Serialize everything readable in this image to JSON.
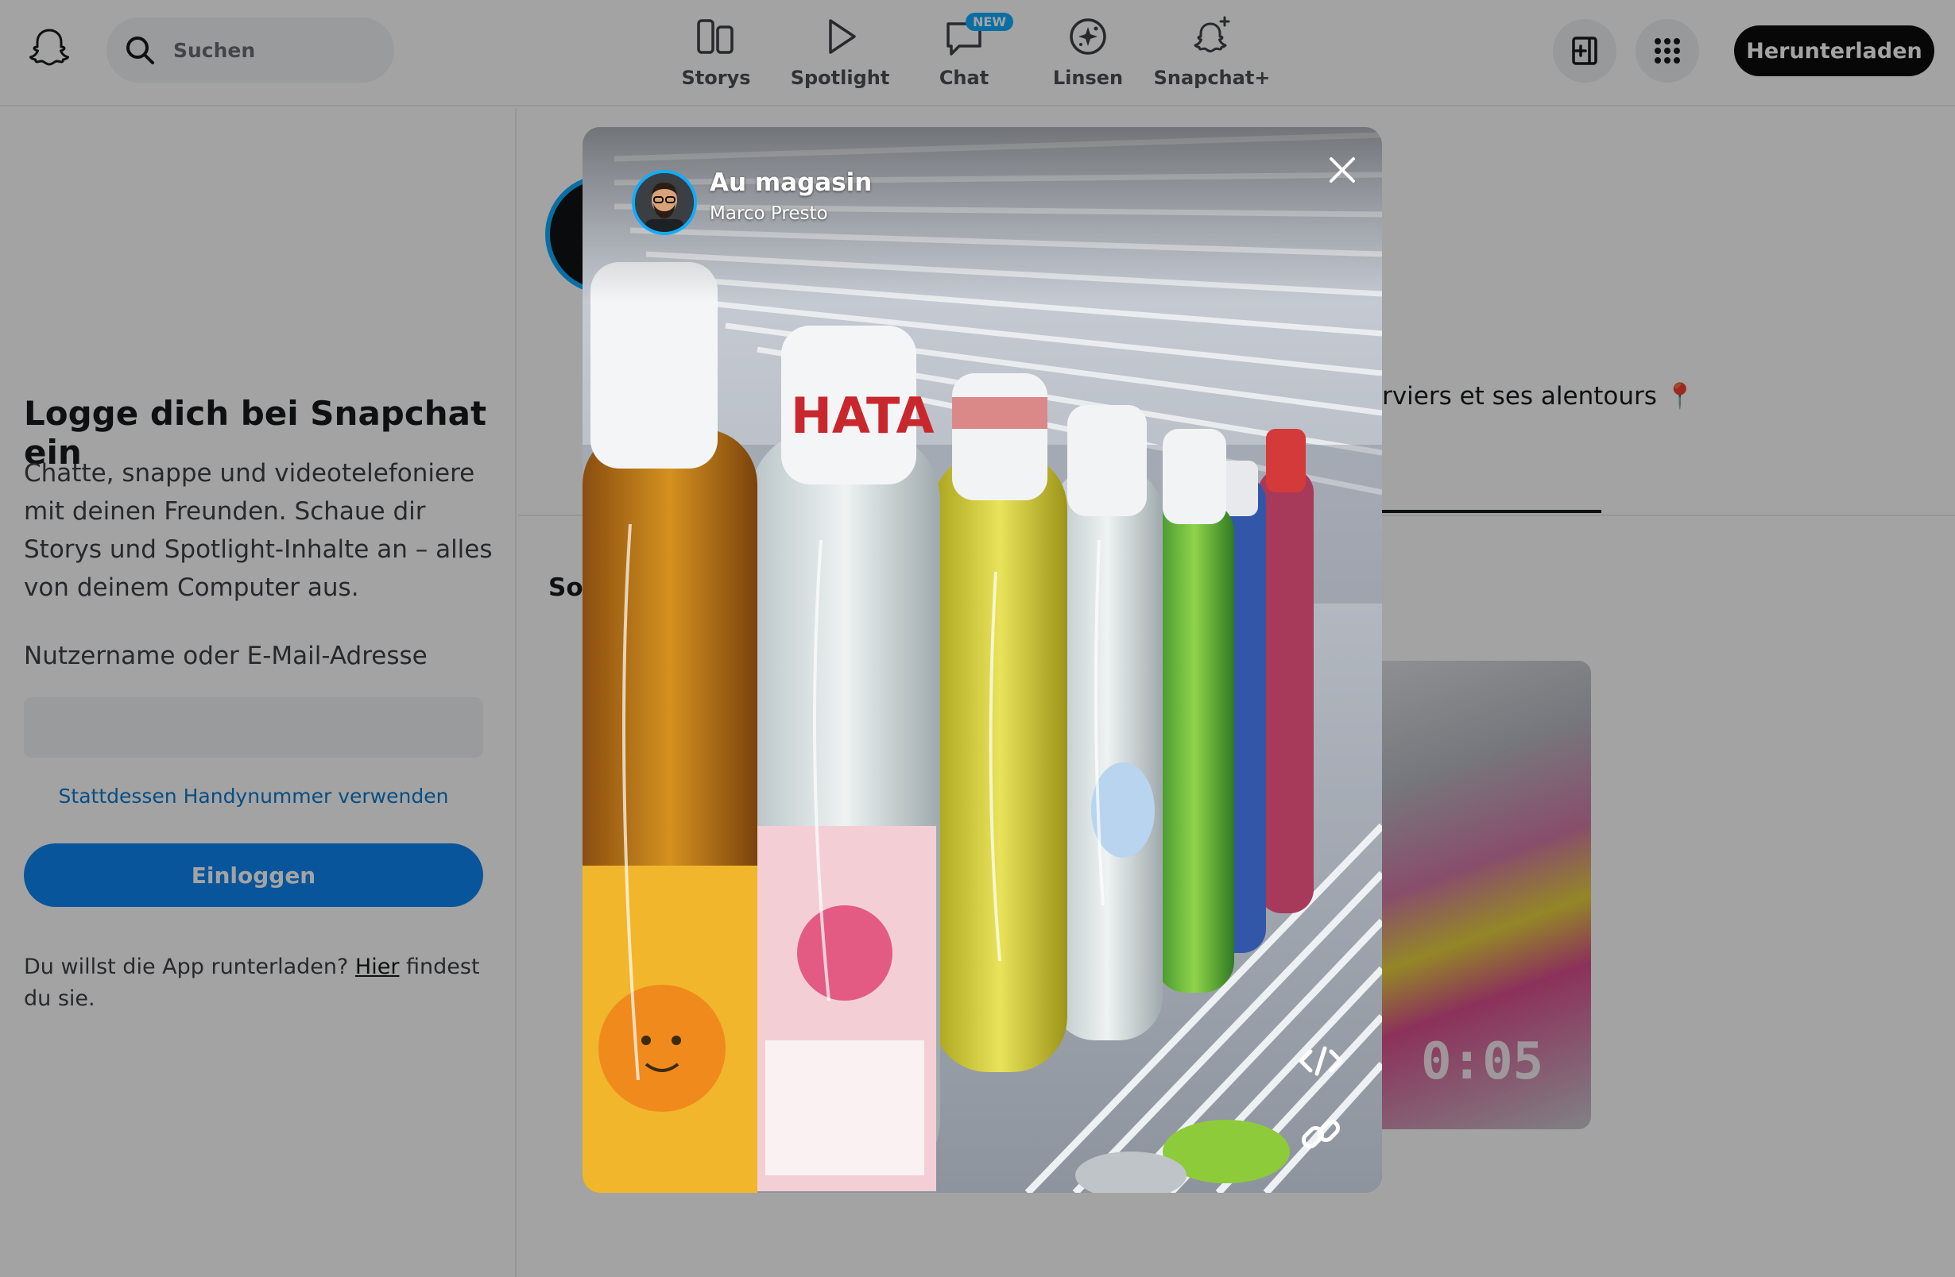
{
  "header": {
    "search_placeholder": "Suchen",
    "nav": [
      {
        "label": "Storys",
        "icon": "storys-icon"
      },
      {
        "label": "Spotlight",
        "icon": "spotlight-play-icon"
      },
      {
        "label": "Chat",
        "icon": "chat-icon",
        "badge": "NEW"
      },
      {
        "label": "Linsen",
        "icon": "lenses-icon"
      },
      {
        "label": "Snapchat+",
        "icon": "snapchat-plus-icon"
      }
    ],
    "download_label": "Herunterladen"
  },
  "login": {
    "title": "Logge dich bei Snapchat ein",
    "subtitle": "Chatte, snappe und videotelefoniere mit deinen Freunden. Schaue dir Storys und Spotlight-Inhalte an – alles von deinem Computer aus.",
    "field_label": "Nutzername oder E-Mail-Adresse",
    "field_value": "",
    "phone_link": "Stattdessen Handynummer verwenden",
    "login_button": "Einloggen",
    "download_prefix": "Du willst die App runterladen? ",
    "download_link": "Hier",
    "download_suffix": " findest du sie."
  },
  "background": {
    "location_text": "erviers et ses alentours",
    "location_pin": "📍",
    "section_label": "So",
    "card_time": "0:05"
  },
  "story": {
    "title": "Au magasin",
    "author": "Marco Presto"
  },
  "colors": {
    "accent_blue": "#0d85f2",
    "link_blue": "#0a7ad1",
    "badge_blue": "#0fadff",
    "download_black": "#0b0b0c"
  }
}
